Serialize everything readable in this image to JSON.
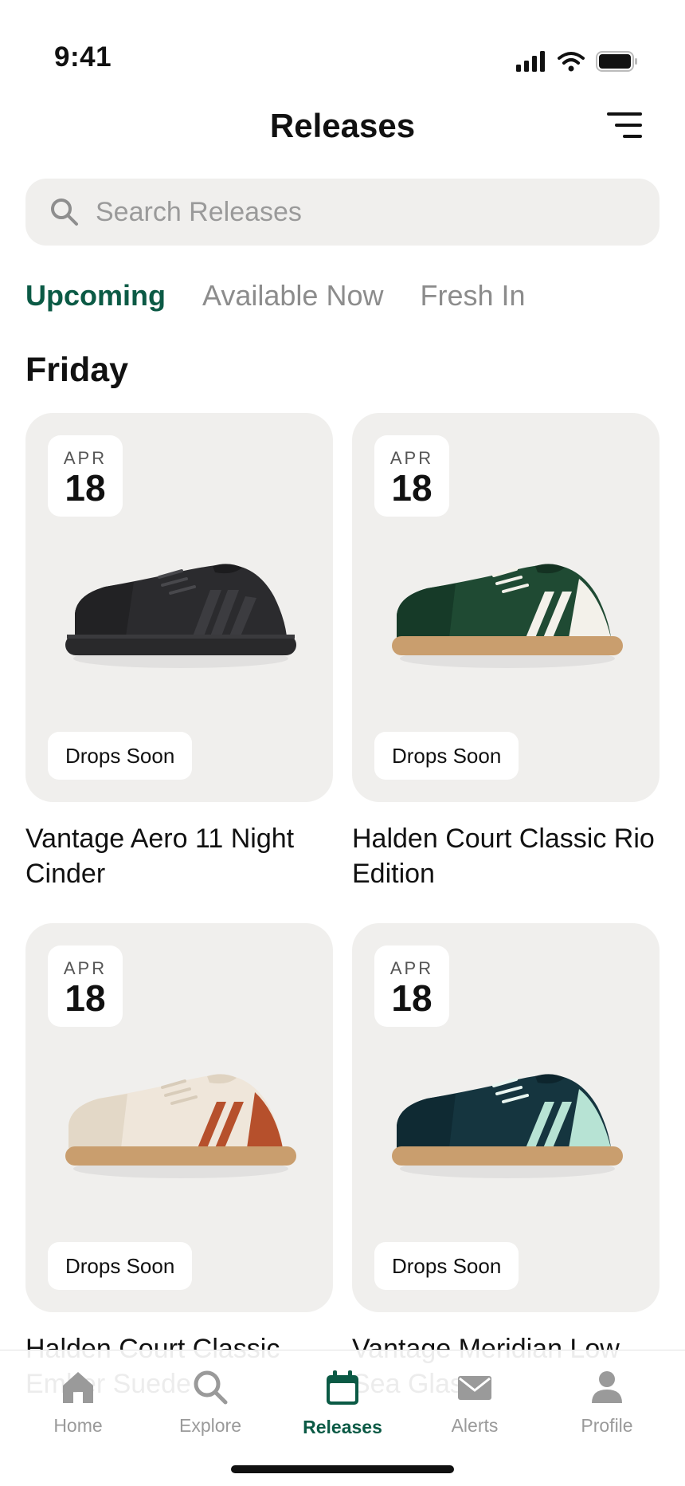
{
  "status": {
    "time": "9:41"
  },
  "header": {
    "title": "Releases"
  },
  "search": {
    "placeholder": "Search Releases"
  },
  "tabs": [
    {
      "label": "Upcoming",
      "active": true
    },
    {
      "label": "Available Now",
      "active": false
    },
    {
      "label": "Fresh In",
      "active": false
    }
  ],
  "section_title": "Friday",
  "products": [
    {
      "month": "APR",
      "day": "18",
      "status": "Drops Soon",
      "name": "Vantage Aero 11 Night Cinder"
    },
    {
      "month": "APR",
      "day": "18",
      "status": "Drops Soon",
      "name": "Halden Court Classic Rio Edition"
    },
    {
      "month": "APR",
      "day": "18",
      "status": "Drops Soon",
      "name": "Halden Court Classic Ember Suede"
    },
    {
      "month": "APR",
      "day": "18",
      "status": "Drops Soon",
      "name": "Vantage Meridian Low Sea Glass"
    }
  ],
  "nav": [
    {
      "label": "Home",
      "icon": "home-icon"
    },
    {
      "label": "Explore",
      "icon": "search-icon"
    },
    {
      "label": "Releases",
      "icon": "calendar-icon",
      "active": true
    },
    {
      "label": "Alerts",
      "icon": "mail-icon"
    },
    {
      "label": "Profile",
      "icon": "person-icon"
    }
  ],
  "colors": {
    "accent": "#0b5a45",
    "card_bg": "#f0efed"
  }
}
